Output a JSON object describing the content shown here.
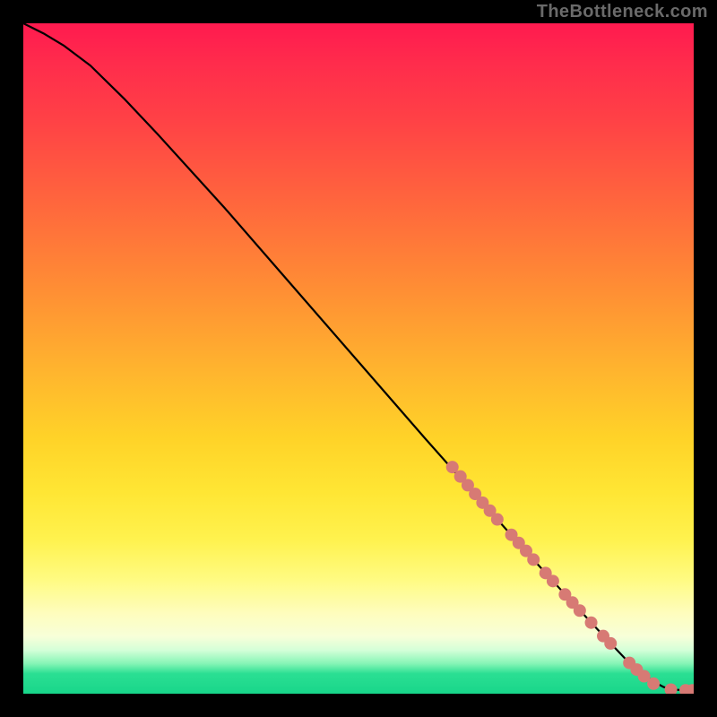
{
  "watermark": "TheBottleneck.com",
  "colors": {
    "dot_fill": "#d77a74",
    "curve_stroke": "#000000"
  },
  "chart_data": {
    "type": "line",
    "title": "",
    "xlabel": "",
    "ylabel": "",
    "xlim": [
      0,
      100
    ],
    "ylim": [
      0,
      100
    ],
    "grid": false,
    "legend": null,
    "series": [
      {
        "name": "curve",
        "x": [
          0,
          3,
          6,
          10,
          15,
          20,
          30,
          40,
          50,
          60,
          68,
          75,
          80,
          85,
          88,
          90,
          92,
          94,
          95.5,
          97,
          99,
          100
        ],
        "y": [
          100,
          98.5,
          96.7,
          93.7,
          88.8,
          83.5,
          72.5,
          61.0,
          49.5,
          38.0,
          29.0,
          21.2,
          15.7,
          10.3,
          7.1,
          5.0,
          3.2,
          1.8,
          1.0,
          0.6,
          0.5,
          0.5
        ]
      }
    ],
    "points": [
      {
        "x": 64.0,
        "y": 33.8
      },
      {
        "x": 65.2,
        "y": 32.4
      },
      {
        "x": 66.3,
        "y": 31.1
      },
      {
        "x": 67.4,
        "y": 29.8
      },
      {
        "x": 68.5,
        "y": 28.5
      },
      {
        "x": 69.6,
        "y": 27.3
      },
      {
        "x": 70.7,
        "y": 26.0
      },
      {
        "x": 72.8,
        "y": 23.7
      },
      {
        "x": 73.9,
        "y": 22.5
      },
      {
        "x": 75.0,
        "y": 21.3
      },
      {
        "x": 76.1,
        "y": 20.0
      },
      {
        "x": 77.9,
        "y": 18.0
      },
      {
        "x": 79.0,
        "y": 16.8
      },
      {
        "x": 80.8,
        "y": 14.8
      },
      {
        "x": 81.9,
        "y": 13.6
      },
      {
        "x": 83.0,
        "y": 12.4
      },
      {
        "x": 84.7,
        "y": 10.6
      },
      {
        "x": 86.5,
        "y": 8.6
      },
      {
        "x": 87.6,
        "y": 7.5
      },
      {
        "x": 90.4,
        "y": 4.6
      },
      {
        "x": 91.5,
        "y": 3.6
      },
      {
        "x": 92.6,
        "y": 2.6
      },
      {
        "x": 94.0,
        "y": 1.5
      },
      {
        "x": 96.6,
        "y": 0.6
      },
      {
        "x": 98.8,
        "y": 0.5
      },
      {
        "x": 99.8,
        "y": 0.5
      }
    ],
    "dot_radius": 7
  }
}
